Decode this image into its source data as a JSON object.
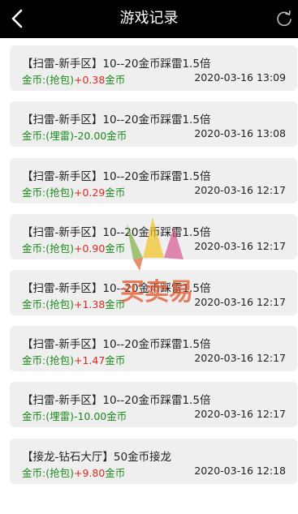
{
  "header": {
    "title": "游戏记录",
    "back_icon": "chevron-left-icon",
    "refresh_icon": "refresh-icon"
  },
  "records": [
    {
      "game": "【扫雷-新手区】10--20金币踩雷1.5倍",
      "prefix": "金币:(抢包)",
      "amount": "+0.38",
      "suffix": "金币",
      "time": "2020-03-16 13:09",
      "amount_color": "red"
    },
    {
      "game": "【扫雷-新手区】10--20金币踩雷1.5倍",
      "prefix": "金币:(埋雷)",
      "amount": "-20.00",
      "suffix": "金币",
      "time": "2020-03-16 13:08",
      "amount_color": "green"
    },
    {
      "game": "【扫雷-新手区】10--20金币踩雷1.5倍",
      "prefix": "金币:(抢包)",
      "amount": "+0.29",
      "suffix": "金币",
      "time": "2020-03-16 12:17",
      "amount_color": "red"
    },
    {
      "game": "【扫雷-新手区】10--20金币踩雷1.5倍",
      "prefix": "金币:(抢包)",
      "amount": "+0.90",
      "suffix": "金币",
      "time": "2020-03-16 12:17",
      "amount_color": "red"
    },
    {
      "game": "【扫雷-新手区】10--20金币踩雷1.5倍",
      "prefix": "金币:(抢包)",
      "amount": "+1.38",
      "suffix": "金币",
      "time": "2020-03-16 12:17",
      "amount_color": "red"
    },
    {
      "game": "【扫雷-新手区】10--20金币踩雷1.5倍",
      "prefix": "金币:(抢包)",
      "amount": "+1.47",
      "suffix": "金币",
      "time": "2020-03-16 12:17",
      "amount_color": "red"
    },
    {
      "game": "【扫雷-新手区】10--20金币踩雷1.5倍",
      "prefix": "金币:(埋雷)",
      "amount": "-10.00",
      "suffix": "金币",
      "time": "2020-03-16 12:17",
      "amount_color": "green"
    },
    {
      "game": "【接龙-钻石大厅】50金币接龙",
      "prefix": "金币:(抢包)",
      "amount": "+9.80",
      "suffix": "金币",
      "time": "2020-03-16 12:18",
      "amount_color": "red"
    }
  ],
  "watermark": {
    "text": "买卖易",
    "colors": [
      "#e2552a",
      "#f2c21b",
      "#7ab03c",
      "#d64b8a"
    ]
  }
}
